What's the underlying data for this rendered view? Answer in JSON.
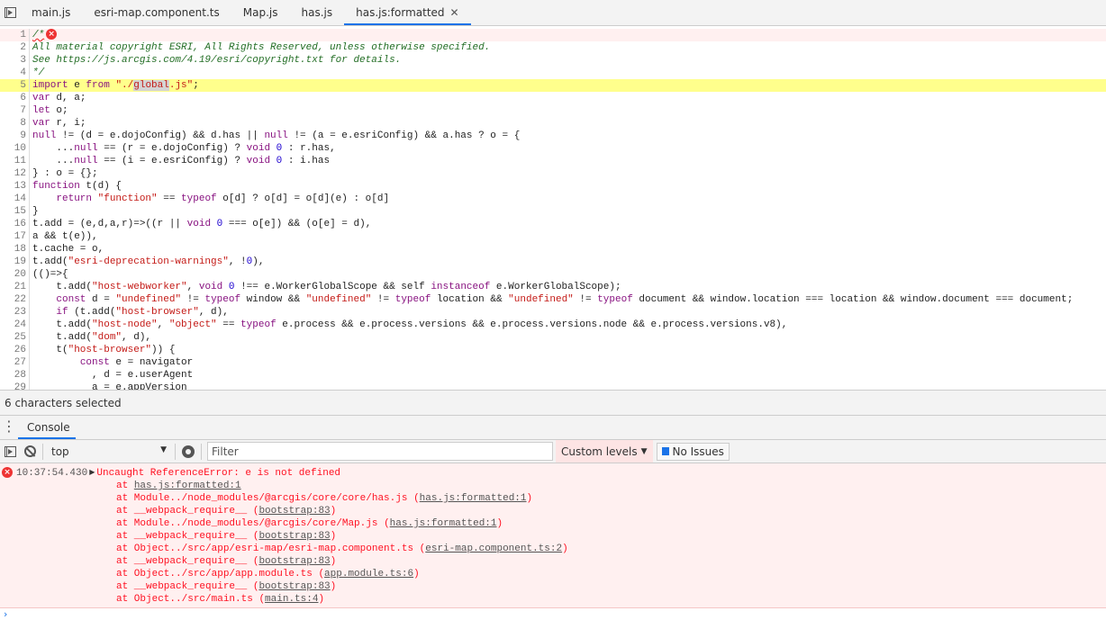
{
  "tabs": [
    {
      "label": "main.js"
    },
    {
      "label": "esri-map.component.ts"
    },
    {
      "label": "Map.js"
    },
    {
      "label": "has.js"
    },
    {
      "label": "has.js:formatted",
      "active": true
    }
  ],
  "editor": {
    "error_line": 1,
    "highlight_line": 5,
    "selection": "global",
    "lines": [
      "/*",
      "All material copyright ESRI, All Rights Reserved, unless otherwise specified.",
      "See https://js.arcgis.com/4.19/esri/copyright.txt for details.",
      "*/",
      "import e from \"./global.js\";",
      "var d, a;",
      "let o;",
      "var r, i;",
      "null != (d = e.dojoConfig) && d.has || null != (a = e.esriConfig) && a.has ? o = {",
      "    ...null == (r = e.dojoConfig) ? void 0 : r.has,",
      "    ...null == (i = e.esriConfig) ? void 0 : i.has",
      "} : o = {};",
      "function t(d) {",
      "    return \"function\" == typeof o[d] ? o[d] = o[d](e) : o[d]",
      "}",
      "t.add = (e,d,a,r)=>((r || void 0 === o[e]) && (o[e] = d),",
      "a && t(e)),",
      "t.cache = o,",
      "t.add(\"esri-deprecation-warnings\", !0),",
      "(()=>{",
      "    t.add(\"host-webworker\", void 0 !== e.WorkerGlobalScope && self instanceof e.WorkerGlobalScope);",
      "    const d = \"undefined\" != typeof window && \"undefined\" != typeof location && \"undefined\" != typeof document && window.location === location && window.document === document;",
      "    if (t.add(\"host-browser\", d),",
      "    t.add(\"host-node\", \"object\" == typeof e.process && e.process.versions && e.process.versions.node && e.process.versions.v8),",
      "    t.add(\"dom\", d),",
      "    t(\"host-browser\")) {",
      "        const e = navigator",
      "          , d = e.userAgent",
      "          a = e.appVersion"
    ]
  },
  "status": "6 characters selected",
  "drawer": {
    "tab": "Console"
  },
  "toolbar": {
    "context": "top",
    "filter_placeholder": "Filter",
    "levels": "Custom levels",
    "issues": "No Issues"
  },
  "console": {
    "timestamp": "10:37:54.430",
    "error": "Uncaught ReferenceError: e is not defined",
    "trace": [
      {
        "text": "at ",
        "link": "has.js:formatted:1"
      },
      {
        "text": "at Module../node_modules/@arcgis/core/core/has.js ",
        "link": "has.js:formatted:1",
        "paren": true
      },
      {
        "text": "at __webpack_require__ ",
        "link": "bootstrap:83",
        "paren": true
      },
      {
        "text": "at Module../node_modules/@arcgis/core/Map.js ",
        "link": "has.js:formatted:1",
        "paren": true
      },
      {
        "text": "at __webpack_require__ ",
        "link": "bootstrap:83",
        "paren": true
      },
      {
        "text": "at Object../src/app/esri-map/esri-map.component.ts ",
        "link": "esri-map.component.ts:2",
        "paren": true
      },
      {
        "text": "at __webpack_require__ ",
        "link": "bootstrap:83",
        "paren": true
      },
      {
        "text": "at Object../src/app/app.module.ts ",
        "link": "app.module.ts:6",
        "paren": true
      },
      {
        "text": "at __webpack_require__ ",
        "link": "bootstrap:83",
        "paren": true
      },
      {
        "text": "at Object../src/main.ts ",
        "link": "main.ts:4",
        "paren": true
      }
    ]
  }
}
